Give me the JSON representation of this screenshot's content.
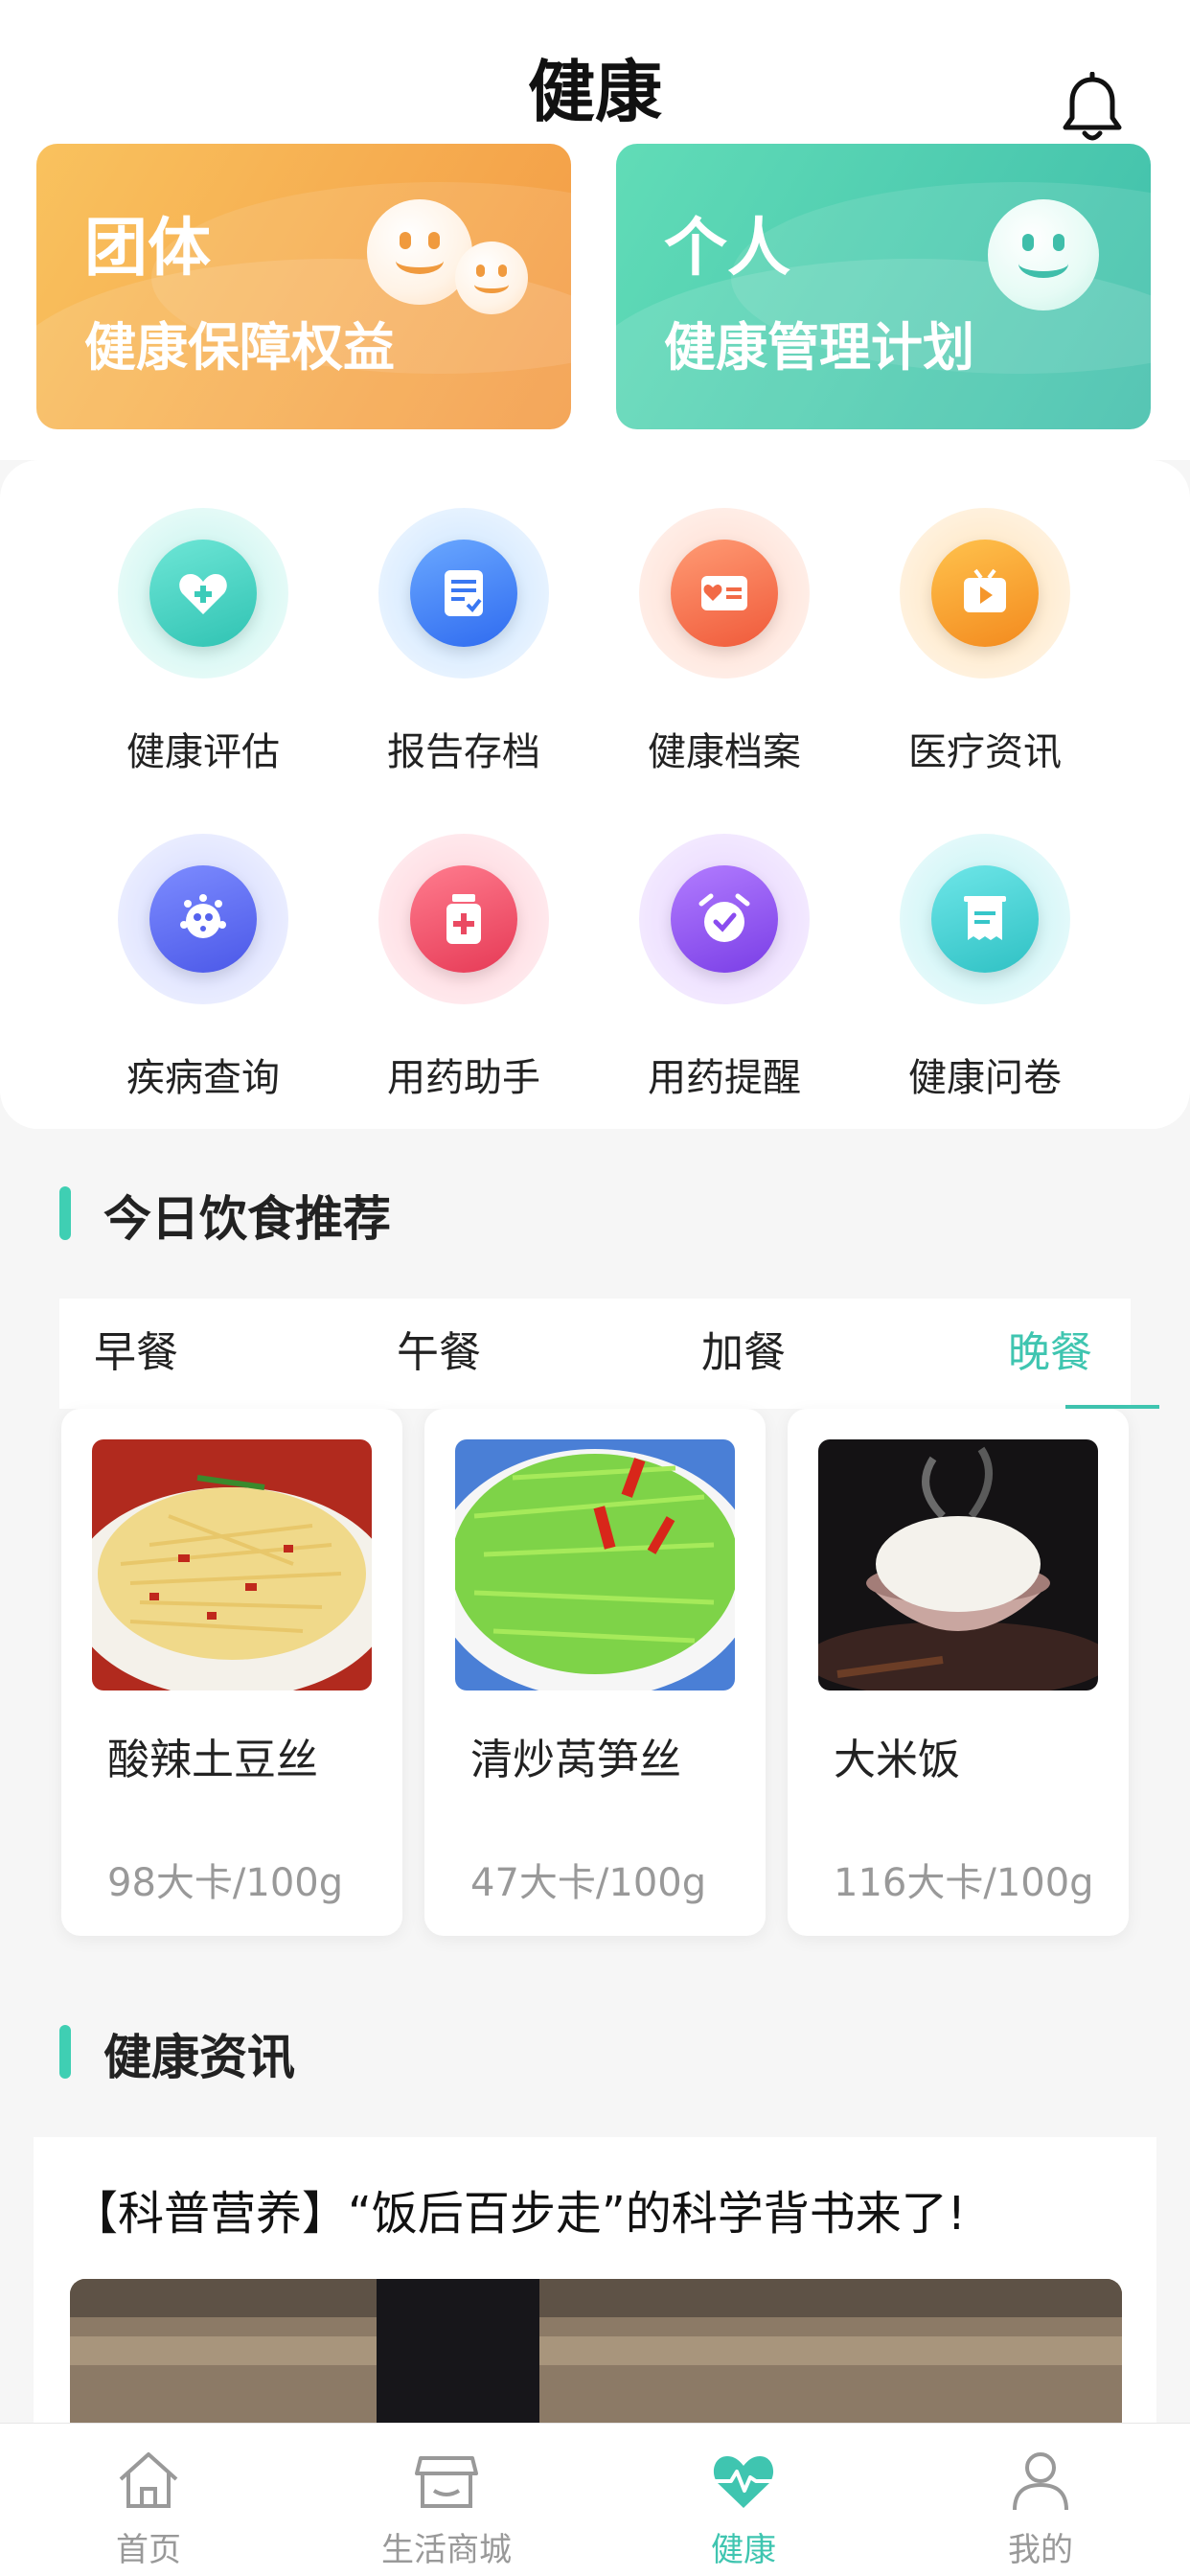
{
  "header": {
    "title": "健康"
  },
  "banners": [
    {
      "title": "团体",
      "subtitle": "健康保障权益",
      "color": "#f5a84a"
    },
    {
      "title": "个人",
      "subtitle": "健康管理计划",
      "color": "#4cc9b0"
    }
  ],
  "services": [
    {
      "label": "健康评估",
      "icon": "heart-plus-icon"
    },
    {
      "label": "报告存档",
      "icon": "document-check-icon"
    },
    {
      "label": "健康档案",
      "icon": "health-record-card-icon"
    },
    {
      "label": "医疗资讯",
      "icon": "tv-play-icon"
    },
    {
      "label": "疾病查询",
      "icon": "virus-icon"
    },
    {
      "label": "用药助手",
      "icon": "medicine-bottle-icon"
    },
    {
      "label": "用药提醒",
      "icon": "alarm-clock-icon"
    },
    {
      "label": "健康问卷",
      "icon": "questionnaire-icon"
    }
  ],
  "diet": {
    "title": "今日饮食推荐",
    "tabs": [
      "早餐",
      "午餐",
      "加餐",
      "晚餐"
    ],
    "active_tab": "晚餐",
    "items": [
      {
        "name": "酸辣土豆丝",
        "kcal": "98大卡/100g"
      },
      {
        "name": "清炒莴笋丝",
        "kcal": "47大卡/100g"
      },
      {
        "name": "大米饭",
        "kcal": "116大卡/100g"
      }
    ]
  },
  "news": {
    "title": "健康资讯",
    "article_title": "【科普营养】“饭后百步走”的科学背书来了!"
  },
  "tabbar": {
    "items": [
      {
        "label": "首页",
        "icon": "home-icon"
      },
      {
        "label": "生活商城",
        "icon": "store-icon"
      },
      {
        "label": "健康",
        "icon": "heartbeat-icon"
      },
      {
        "label": "我的",
        "icon": "user-icon"
      }
    ],
    "active": "健康"
  },
  "colors": {
    "accent": "#3fc5b0",
    "text": "#222222",
    "muted": "#999999"
  }
}
